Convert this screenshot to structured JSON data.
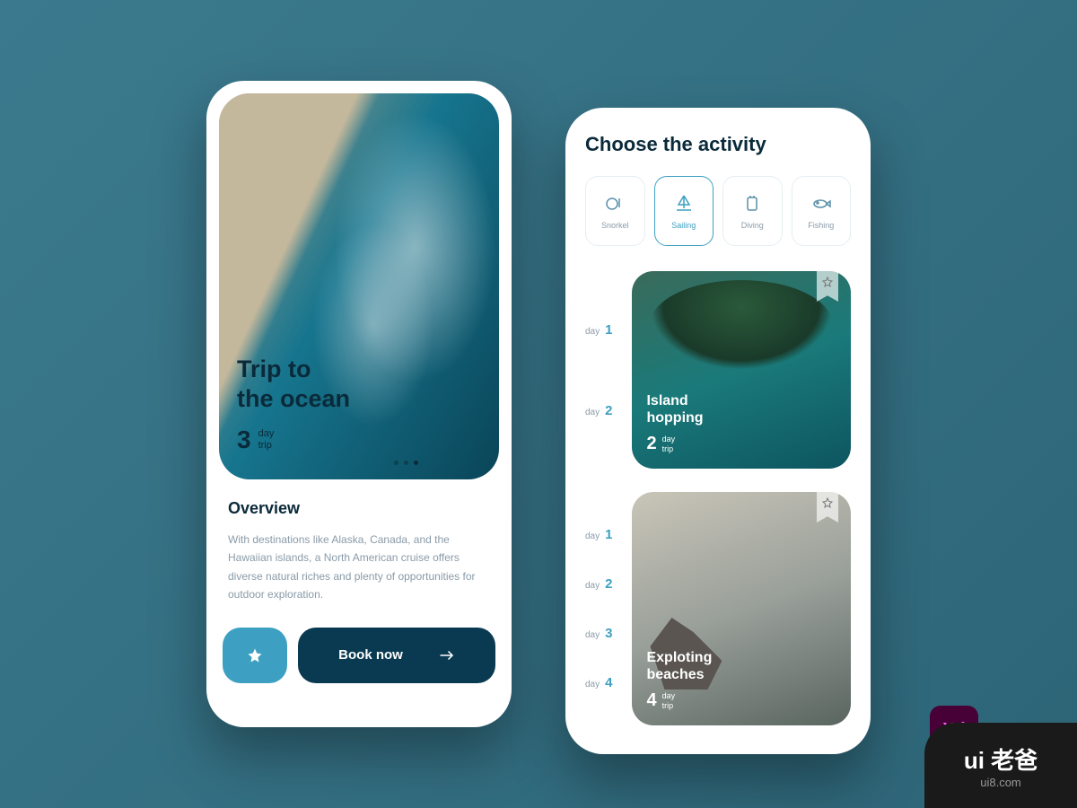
{
  "left": {
    "hero": {
      "title_line1": "Trip to",
      "title_line2": "the ocean",
      "count": "3",
      "unit_line1": "day",
      "unit_line2": "trip"
    },
    "overview": {
      "heading": "Overview",
      "body": "With destinations like Alaska, Canada, and the Hawaiian islands, a North American cruise offers diverse natural riches and plenty of opportunities for outdoor exploration."
    },
    "actions": {
      "book_label": "Book now"
    }
  },
  "right": {
    "title": "Choose the activity",
    "activities": [
      {
        "label": "Snorkel",
        "icon": "snorkel"
      },
      {
        "label": "Sailing",
        "icon": "sailing"
      },
      {
        "label": "Diving",
        "icon": "diving"
      },
      {
        "label": "Fishing",
        "icon": "fishing"
      }
    ],
    "selected_activity": "Sailing",
    "trips": [
      {
        "title_line1": "Island",
        "title_line2": "hopping",
        "count": "2",
        "unit_line1": "day",
        "unit_line2": "trip",
        "days": [
          "1",
          "2"
        ]
      },
      {
        "title_line1": "Exploting",
        "title_line2": "beaches",
        "count": "4",
        "unit_line1": "day",
        "unit_line2": "trip",
        "days": [
          "1",
          "2",
          "3",
          "4"
        ]
      }
    ],
    "day_label": "day"
  },
  "badges": {
    "xd": "Xd",
    "ui8_main": "ui 老爸",
    "ui8_sub": "ui8.com"
  }
}
